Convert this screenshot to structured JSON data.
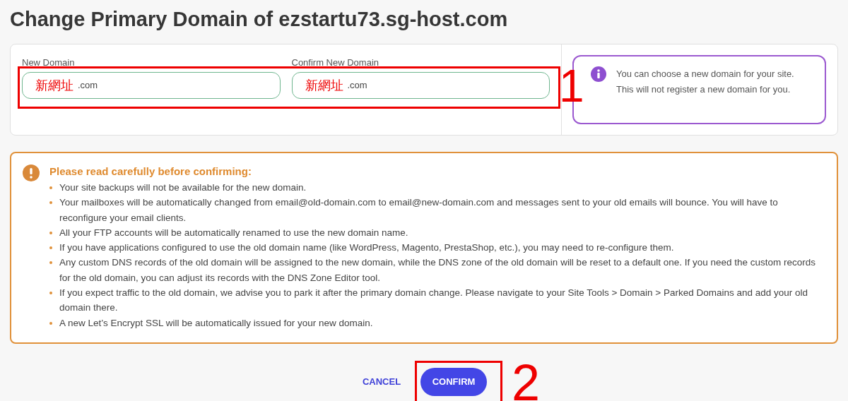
{
  "title": "Change Primary Domain of ezstartu73.sg-host.com",
  "fields": [
    {
      "label": "New Domain",
      "value": ".com",
      "annotation": "新網址"
    },
    {
      "label": "Confirm New Domain",
      "value": ".com",
      "annotation": "新網址"
    }
  ],
  "info": "You can choose a new domain for your site. This will not register a new domain for you.",
  "warning": {
    "heading": "Please read carefully before confirming:",
    "items": [
      "Your site backups will not be available for the new domain.",
      "Your mailboxes will be automatically changed from email@old-domain.com to email@new-domain.com and messages sent to your old emails will bounce. You will have to reconfigure your email clients.",
      "All your FTP accounts will be automatically renamed to use the new domain name.",
      "If you have applications configured to use the old domain name (like WordPress, Magento, PrestaShop, etc.), you may need to re-configure them.",
      "Any custom DNS records of the old domain will be assigned to the new domain, while the DNS zone of the old domain will be reset to a default one. If you need the custom records for the old domain, you can adjust its records with the DNS Zone Editor tool.",
      "If you expect traffic to the old domain, we advise you to park it after the primary domain change. Please navigate to your Site Tools > Domain > Parked Domains and add your old domain there.",
      "A new Let’s Encrypt SSL will be automatically issued for your new domain."
    ]
  },
  "buttons": {
    "cancel": "CANCEL",
    "confirm": "CONFIRM"
  },
  "step_marks": [
    "1",
    "2"
  ]
}
